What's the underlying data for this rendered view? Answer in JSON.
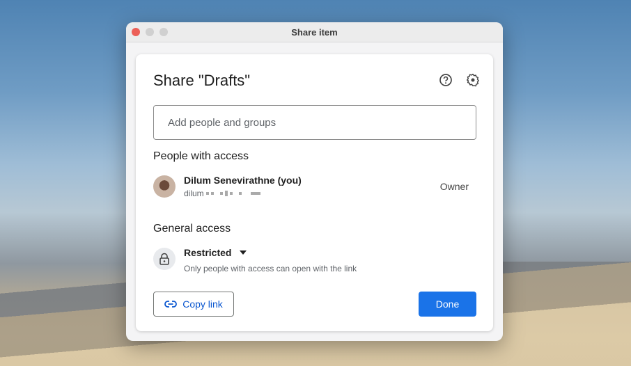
{
  "window": {
    "title": "Share item",
    "controls": {
      "close_color": "#ec5f57",
      "inactive_color": "#d0d0d0"
    }
  },
  "dialog": {
    "title": "Share \"Drafts\"",
    "icons": [
      "help-icon",
      "settings-icon"
    ],
    "add_people": {
      "placeholder": "Add people and groups",
      "value": ""
    },
    "people_section": "People with access",
    "people": [
      {
        "name": "Dilum Senevirathne (you)",
        "email_visible": "dilum",
        "role": "Owner"
      }
    ],
    "general_section": "General access",
    "access": {
      "level": "Restricted",
      "description": "Only people with access can open with the link"
    },
    "copy_link": "Copy link",
    "done": "Done",
    "accent": "#1a73e8"
  }
}
